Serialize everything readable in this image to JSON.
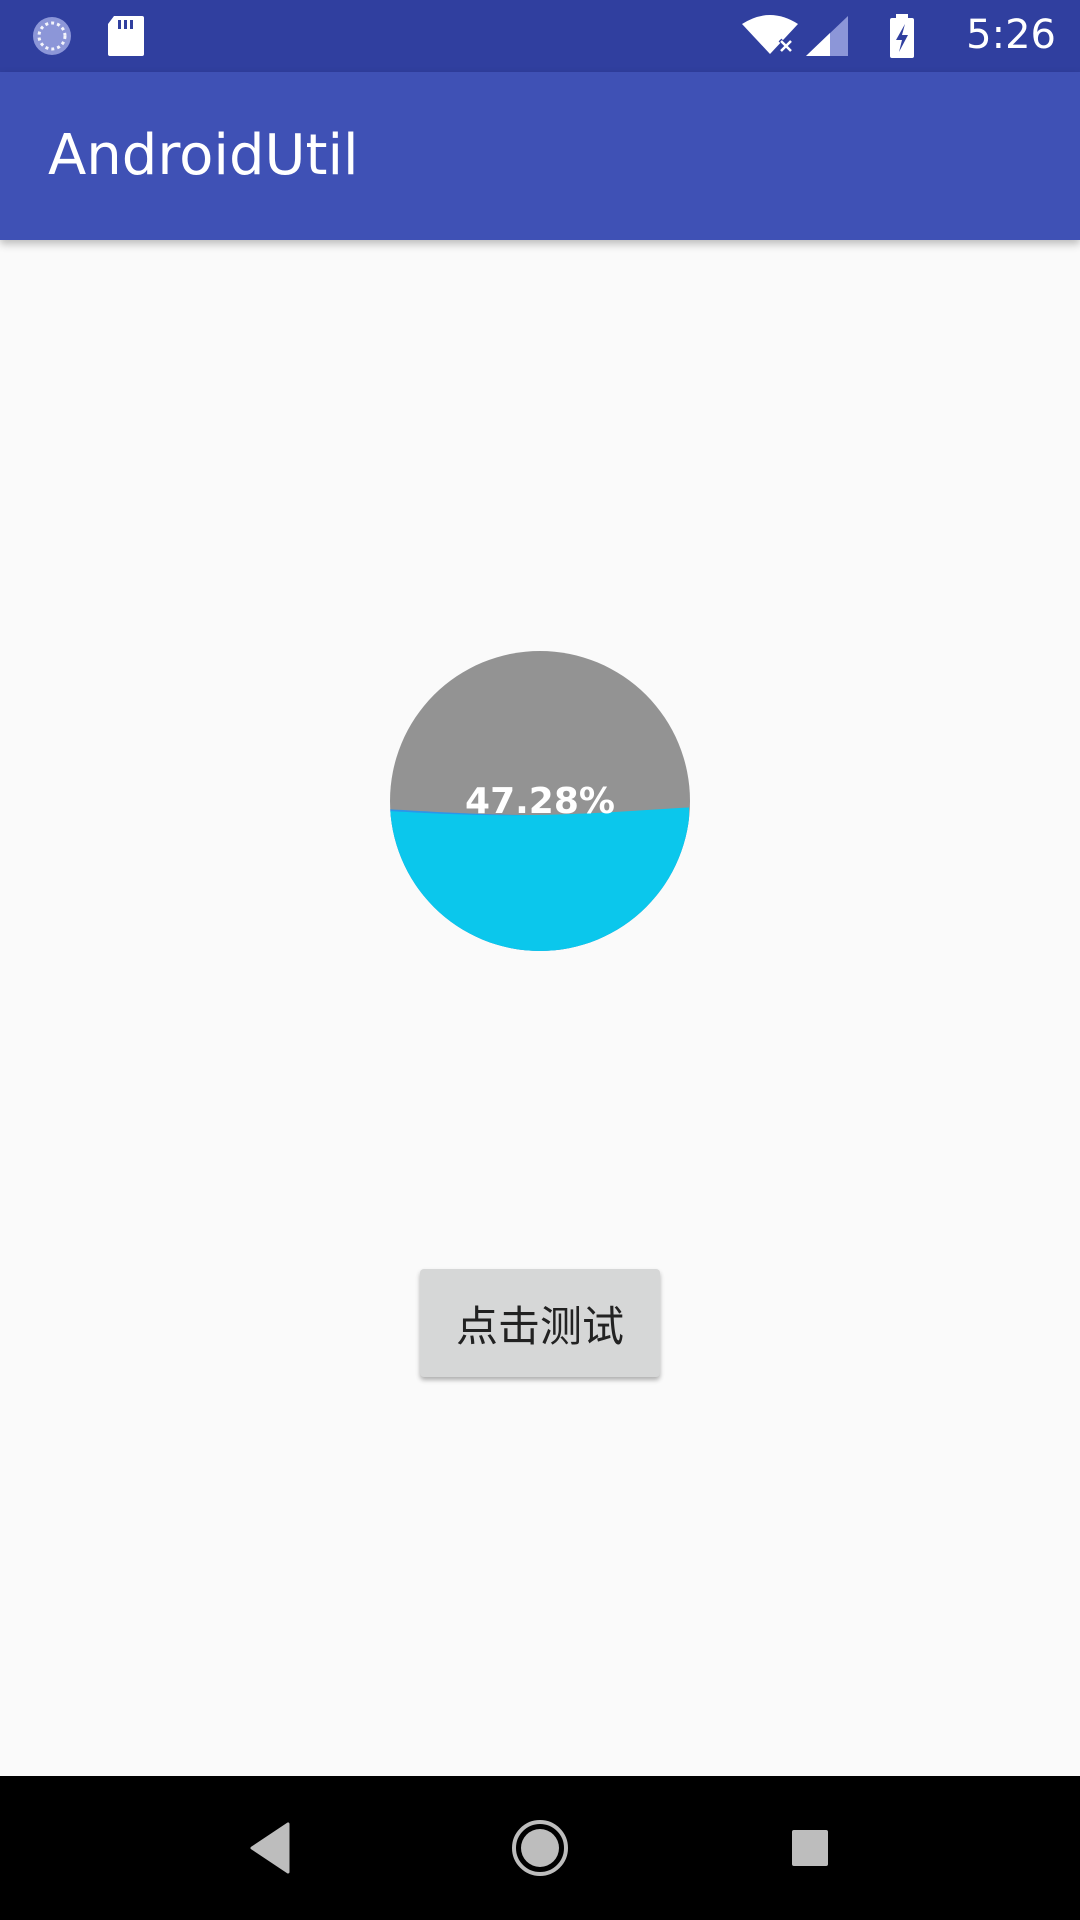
{
  "status_bar": {
    "time": "5:26",
    "icons": [
      "sync-icon",
      "sd-card-icon",
      "wifi-off-icon",
      "cell-signal-icon",
      "battery-charging-icon"
    ]
  },
  "app_bar": {
    "title": "AndroidUtil"
  },
  "wave_progress": {
    "label": "47.28%",
    "percent": 47.28,
    "fill_color": "#0bc7ec",
    "empty_color": "#939393"
  },
  "test_button": {
    "label": "点击测试"
  },
  "nav_bar": {
    "icons": [
      "back-icon",
      "home-icon",
      "recents-icon"
    ]
  },
  "colors": {
    "status_bar": "#303f9f",
    "primary": "#3f51b5",
    "background": "#fafafa"
  }
}
